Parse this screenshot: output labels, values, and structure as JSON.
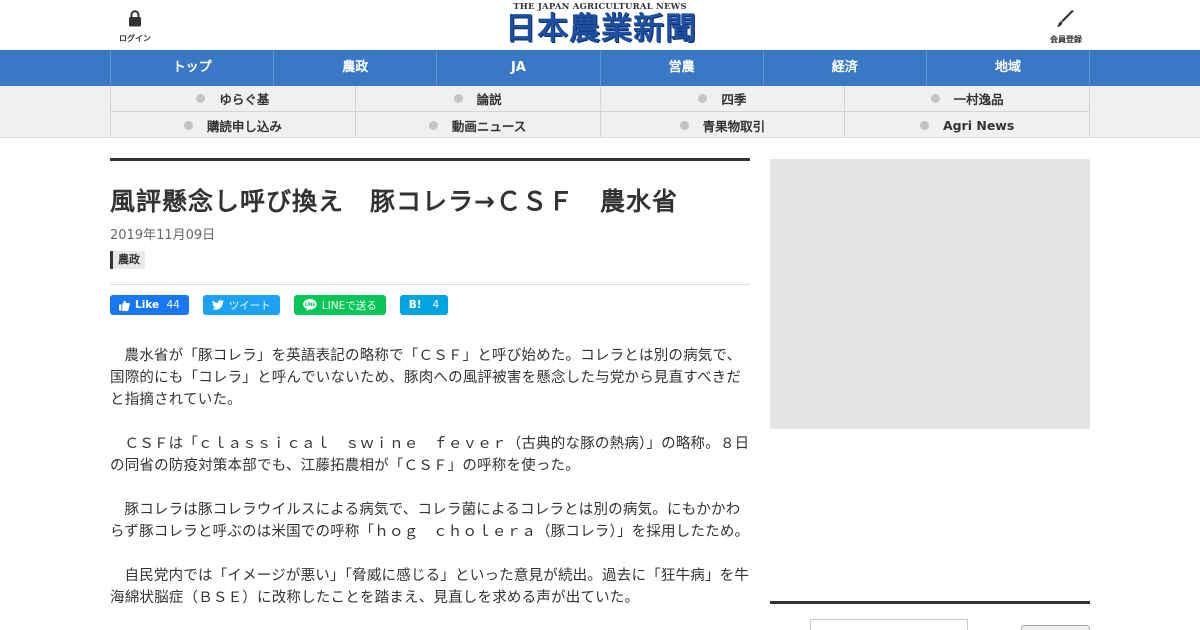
{
  "header": {
    "login_label": "ログイン",
    "member_label": "会員登録",
    "logo_en": "THE JAPAN AGRICULTURAL NEWS",
    "logo_ja": "日本農業新聞",
    "brand_color": "#1e4fa0"
  },
  "main_nav": {
    "color": "#3a78c5",
    "items": [
      "トップ",
      "農政",
      "JA",
      "営農",
      "経済",
      "地域"
    ]
  },
  "sub_nav": {
    "items": [
      "ゆらぐ基",
      "論説",
      "四季",
      "一村逸品",
      "購読申し込み",
      "動画ニュース",
      "青果物取引",
      "Agri News"
    ]
  },
  "article": {
    "title": "風評懸念し呼び換え　豚コレラ→ＣＳＦ　農水省",
    "date": "2019年11月09日",
    "category": "農政",
    "share": {
      "facebook_label": "Like",
      "facebook_count": "44",
      "twitter_label": "ツイート",
      "line_label": "LINEで送る",
      "hatena_label": "B!",
      "hatena_count": "4"
    },
    "paragraphs": [
      "農水省が「豚コレラ」を英語表記の略称で「ＣＳＦ」と呼び始めた。コレラとは別の病気で、国際的にも「コレラ」と呼んでいないため、豚肉への風評被害を懸念した与党から見直すべきだと指摘されていた。",
      "ＣＳＦは「ｃｌａｓｓｉｃａｌ　ｓｗｉｎｅ　ｆｅｖｅｒ（古典的な豚の熱病）」の略称。８日の同省の防疫対策本部でも、江藤拓農相が「ＣＳＦ」の呼称を使った。",
      "豚コレラは豚コレラウイルスによる病気で、コレラ菌によるコレラとは別の病気。にもかかわらず豚コレラと呼ぶのは米国での呼称「ｈｏｇ　ｃｈｏｌｅｒａ（豚コレラ）」を採用したため。",
      "自民党内では「イメージが悪い」「脅威に感じる」といった意見が続出。過去に「狂牛病」を牛海綿状脳症（ＢＳＥ）に改称したことを踏まえ、見直しを求める声が出ていた。"
    ]
  },
  "icons": {
    "login": "lock-icon",
    "member": "pen-icon",
    "subnav_bullet": "circle-bullet-icon",
    "facebook": "thumbs-up-icon",
    "twitter": "twitter-bird-icon",
    "line": "line-icon"
  }
}
